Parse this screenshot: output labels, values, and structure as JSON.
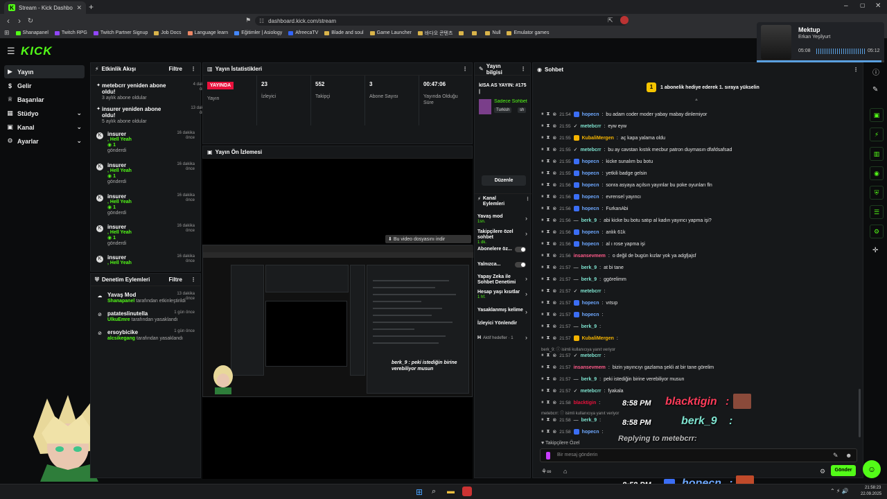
{
  "browser": {
    "tab_title": "Stream - Kick Dashboard",
    "url": "dashboard.kick.com/stream",
    "bookmarks": [
      "Shanapanel",
      "Twitch RPG",
      "Twitch Partner Signup",
      "Job Docs",
      "Language learn",
      "Eğitimler | Asiology",
      "AfreecaTV",
      "Blade and soul",
      "Game Launcher",
      "바다오 콘텐츠",
      "",
      "",
      "Null",
      "Emulator games"
    ]
  },
  "music": {
    "title": "Mektup",
    "artist": "Erkan Yeşilyurt",
    "elapsed": "05:08",
    "total": "05:12",
    "progress": 0.98
  },
  "sidebar": {
    "logo": "KICK",
    "items": [
      {
        "label": "Yayın",
        "icon": "video-icon",
        "active": true,
        "chevron": false
      },
      {
        "label": "Gelir",
        "icon": "money-icon",
        "active": false,
        "chevron": false
      },
      {
        "label": "Başarılar",
        "icon": "trophy-icon",
        "active": false,
        "chevron": false
      },
      {
        "label": "Stüdyo",
        "icon": "studio-icon",
        "active": false,
        "chevron": true
      },
      {
        "label": "Kanal",
        "icon": "channel-icon",
        "active": false,
        "chevron": true
      },
      {
        "label": "Ayarlar",
        "icon": "gear-icon",
        "active": false,
        "chevron": true
      }
    ]
  },
  "activity": {
    "title": "Etkinlik Akışı",
    "filter": "Filtre",
    "events": [
      {
        "title": "metebcrr yeniden abone oldu!",
        "sub": "3 aylık abone oldular",
        "ago": "4 dakika önce"
      },
      {
        "title": "insurer yeniden abone oldu!",
        "sub": "5 aylık abone oldular",
        "ago": "13 dakika önce"
      },
      {
        "title": "insurer",
        "msg": ", Hell Yeah",
        "count": "1",
        "sub": "gönderdi",
        "ago": "16 dakika önce"
      },
      {
        "title": "insurer",
        "msg": ", Hell Yeah",
        "count": "1",
        "sub": "gönderdi",
        "ago": "16 dakika önce"
      },
      {
        "title": "insurer",
        "msg": ", Hell Yeah",
        "count": "1",
        "sub": "gönderdi",
        "ago": "16 dakika önce"
      },
      {
        "title": "insurer",
        "msg": ", Hell Yeah",
        "count": "1",
        "sub": "gönderdi",
        "ago": "16 dakika önce"
      },
      {
        "title": "insurer",
        "msg": ", Hell Yeah",
        "ago": "16 dakika önce"
      }
    ]
  },
  "moderation": {
    "title": "Denetim Eylemleri",
    "filter": "Filtre",
    "items": [
      {
        "title": "Yavaş Mod",
        "user": "Shanapanel",
        "action": "tarafından etkinleştirildi",
        "ago": "13 dakika önce"
      },
      {
        "title": "patateslinutella",
        "user": "UlkuEmre",
        "action": "tarafından yasaklandı",
        "ago": "1 gün önce"
      },
      {
        "title": "ersoybicike",
        "user": "alcsikegang",
        "action": "tarafından yasaklandı",
        "ago": "1 gün önce"
      }
    ]
  },
  "stats": {
    "title": "Yayın İstatistikleri",
    "cols": [
      {
        "value": "YAYINDA",
        "label": "Yayın"
      },
      {
        "value": "23",
        "label": "İzleyici"
      },
      {
        "value": "552",
        "label": "Takipçi"
      },
      {
        "value": "3",
        "label": "Abone Sayısı"
      },
      {
        "value": "00:47:06",
        "label": "Yayında Olduğu Süre"
      }
    ]
  },
  "preview": {
    "title": "Yayın Ön İzlemesi",
    "download_tip": "Bu video dosyasını indir",
    "overlay_line1": "berk_9 : peki istediğin birine",
    "overlay_line2": "verebiliyor musun"
  },
  "info": {
    "title": "Yayın bilgisi",
    "stream_title": "kISA AS YAYIN: #175 |",
    "category": "Sadece Sohbet",
    "tags": [
      "Turkish",
      "sh"
    ],
    "edit": "Düzenle"
  },
  "channel_actions": {
    "title": "Kanal Eylemleri",
    "items": [
      {
        "name": "Yavaş mod",
        "value": "1sn.",
        "type": "arrow"
      },
      {
        "name": "Takipçilere özel sohbet",
        "value": "1 dk.",
        "type": "arrow"
      },
      {
        "name": "Abonelere öz...",
        "type": "toggle"
      },
      {
        "name": "Yalnızca...",
        "type": "toggle"
      },
      {
        "name": "Yapay Zeka ile Sohbet Denetimi",
        "type": "arrow"
      },
      {
        "name": "Hesap yaşı kısıtlar",
        "value": "1 hf.",
        "type": "arrow"
      },
      {
        "name": "Yasaklanmış kelime",
        "type": "arrow"
      },
      {
        "name": "İzleyici Yönlendir",
        "type": "none"
      },
      {
        "name": "H",
        "value": "Aktif hedefler · 1",
        "type": "arrow"
      }
    ]
  },
  "chat": {
    "title": "Sohbet",
    "pinned": "1 abonelik hediye ederek 1. sıraya yükselin",
    "pinned_rank": "1",
    "messages": [
      {
        "time": "21:54",
        "user": "hopecn",
        "color": "#6ea8ff",
        "text": "bu adam coder moder yabay mabay dinlemiyor",
        "badge": "#3b6ef5"
      },
      {
        "time": "21:55",
        "user": "metebcrr",
        "color": "#7fe4d0",
        "text": "eyw eyw",
        "badge": "",
        "prefix": "✓"
      },
      {
        "time": "21:55",
        "user": "KubaliMergen",
        "color": "#f5b400",
        "text": "aç kapa yalama oldu",
        "badge": "#f5b400"
      },
      {
        "time": "21:55",
        "user": "metebcrr",
        "color": "#7fe4d0",
        "text": "bu ay cavstan kıstık mecbur patron duymasın dfafdsafsad",
        "badge": "",
        "prefix": "✓"
      },
      {
        "time": "21:55",
        "user": "hopecn",
        "color": "#6ea8ff",
        "text": "kicke sunalım bu botu",
        "badge": "#3b6ef5"
      },
      {
        "time": "21:55",
        "user": "hopecn",
        "color": "#6ea8ff",
        "text": "yetkili badge gelsin",
        "badge": "#3b6ef5"
      },
      {
        "time": "21:56",
        "user": "hopecn",
        "color": "#6ea8ff",
        "text": "sonra asyaya açılsın yayınlar bu poke oyunları fln",
        "badge": "#3b6ef5"
      },
      {
        "time": "21:56",
        "user": "hopecn",
        "color": "#6ea8ff",
        "text": "evrensel yayıncı",
        "badge": "#3b6ef5"
      },
      {
        "time": "21:56",
        "user": "hopecn",
        "color": "#6ea8ff",
        "text": "FurkanAbi",
        "badge": "#3b6ef5"
      },
      {
        "time": "21:56",
        "user": "berk_9",
        "color": "#7fe4d0",
        "text": "abi kicke bu botu satıp al kadın yayıncı yapma işi?",
        "badge": "",
        "prefix": "—"
      },
      {
        "time": "21:56",
        "user": "hopecn",
        "color": "#6ea8ff",
        "text": "anlık 61k",
        "badge": "#3b6ef5"
      },
      {
        "time": "21:56",
        "user": "hopecn",
        "color": "#6ea8ff",
        "text": "al ı rose yapma işi",
        "badge": "#3b6ef5"
      },
      {
        "time": "21:56",
        "user": "insansevmem",
        "color": "#ff5a8a",
        "text": "o değil de bugün kızlar yok ya adgfjajsf",
        "badge": ""
      },
      {
        "time": "21:57",
        "user": "berk_9",
        "color": "#7fe4d0",
        "text": "at bi tane",
        "badge": "",
        "prefix": "—"
      },
      {
        "time": "21:57",
        "user": "berk_9",
        "color": "#7fe4d0",
        "text": "ggörelimm",
        "badge": "",
        "prefix": "—"
      },
      {
        "time": "21:57",
        "user": "metebcrr",
        "color": "#7fe4d0",
        "text": "",
        "badge": "",
        "prefix": "✓"
      },
      {
        "time": "21:57",
        "user": "hopecn",
        "color": "#6ea8ff",
        "text": "vıtsıp",
        "badge": "#3b6ef5"
      },
      {
        "time": "21:57",
        "user": "hopecn",
        "color": "#6ea8ff",
        "text": "",
        "badge": "#3b6ef5"
      },
      {
        "time": "21:57",
        "user": "berk_9",
        "color": "#7fe4d0",
        "text": "",
        "badge": "",
        "prefix": "—"
      },
      {
        "time": "21:57",
        "user": "KubaliMergen",
        "color": "#f5b400",
        "text": "",
        "badge": "#f5b400"
      },
      {
        "time": "21:57",
        "user": "metebcrr",
        "color": "#7fe4d0",
        "text": "",
        "badge": "",
        "prefix": "✓"
      },
      {
        "time": "21:57",
        "user": "insansevmem",
        "color": "#ff5a8a",
        "text": "bizin yayıncıyı gazlama şekli at bir tane görelim",
        "badge": ""
      },
      {
        "time": "21:57",
        "user": "berk_9",
        "color": "#7fe4d0",
        "text": "peki istediğin birine verebiliyor musun",
        "badge": "",
        "prefix": "—"
      },
      {
        "time": "21:57",
        "user": "metebcrr",
        "color": "#7fe4d0",
        "text": "fyakala",
        "badge": "",
        "prefix": "✓"
      },
      {
        "time": "21:58",
        "user": "blacktigin",
        "color": "#e9113c",
        "text": "",
        "badge": ""
      },
      {
        "time": "21:58",
        "user": "berk_9",
        "color": "#7fe4d0",
        "text": "",
        "badge": "",
        "prefix": "—"
      },
      {
        "time": "21:58",
        "user": "hopecn",
        "color": "#6ea8ff",
        "text": "",
        "badge": "#3b6ef5"
      }
    ],
    "reply_note_1": "berk_9: ⓘ isimli kullanıcıya yanıt veriyor",
    "reply_note_2": "metebcrr: ⓘ isimli kullanıcıya yanıt veriyor",
    "followers_only": "Takipçilere Özel",
    "input_placeholder": "Bir mesaj gönderin",
    "send": "Gönder",
    "overlay": {
      "time": "8:58 PM",
      "u1": "blacktigin",
      "u2": "berk_9",
      "u3": "hopecn",
      "reply": "Replying to metebcrr:"
    }
  },
  "taskbar": {
    "time": "21:58:23",
    "date": "22.09.2025"
  },
  "colors": {
    "accent": "#53fc18",
    "live": "#e9113c",
    "panel": "#16181a"
  }
}
